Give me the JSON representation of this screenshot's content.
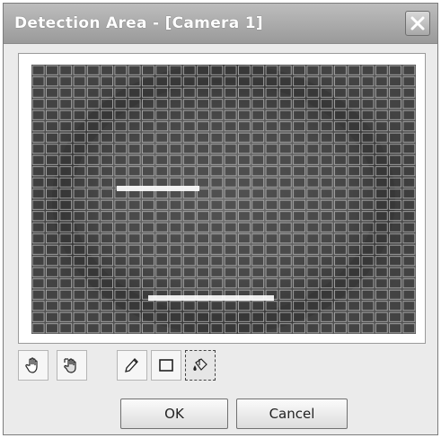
{
  "window": {
    "title": "Detection Area - [Camera 1]"
  },
  "toolbar": {
    "tools": [
      {
        "icon": "hand-icon"
      },
      {
        "icon": "hand-select-icon"
      },
      {
        "icon": "pencil-icon"
      },
      {
        "icon": "rectangle-icon"
      },
      {
        "icon": "fill-bucket-icon"
      }
    ],
    "active_tool": 4
  },
  "buttons": {
    "ok_label": "OK",
    "cancel_label": "Cancel"
  },
  "grid": {
    "columns": 28,
    "rows": 24,
    "cell_color": "#3a3a3a",
    "line_color": "#a8a8a8",
    "highlight_color": "#ffffff"
  }
}
